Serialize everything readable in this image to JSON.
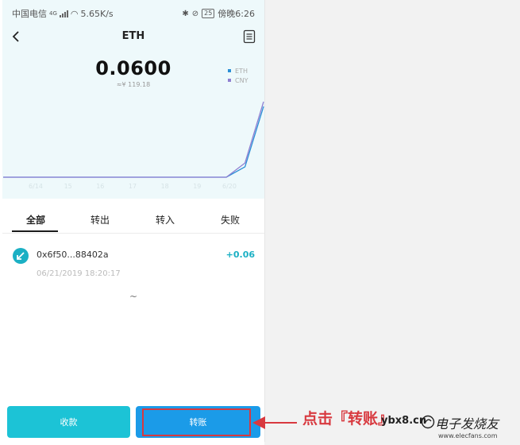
{
  "status_bar": {
    "carrier": "中国电信",
    "net_badge": "4G",
    "speed": "5.65K/s",
    "battery": "25",
    "time": "傍晚6:26"
  },
  "header": {
    "title": "ETH"
  },
  "balance": {
    "amount": "0.0600",
    "fiat": "≈¥ 119.18"
  },
  "legend": [
    {
      "label": "ETH",
      "color": "#2a8fd6"
    },
    {
      "label": "CNY",
      "color": "#8f7fd1"
    }
  ],
  "chart_data": {
    "type": "line",
    "title": "",
    "xlabel": "",
    "ylabel": "",
    "x_tick_labels": [
      "6/14",
      "15",
      "16",
      "17",
      "18",
      "19",
      "6/20"
    ],
    "grid": false,
    "legend_position": "top-right",
    "series": [
      {
        "name": "ETH",
        "color": "#2a8fd6",
        "values": [
          0,
          0,
          0,
          0,
          0,
          0,
          0,
          0,
          0,
          0,
          0,
          0,
          0,
          0.0083,
          0.0563
        ]
      },
      {
        "name": "CNY",
        "color": "#8f7fd1",
        "values": [
          0,
          0,
          0,
          0,
          0,
          0,
          0,
          0,
          0,
          0,
          0,
          0,
          0,
          0.0113,
          0.06
        ]
      }
    ],
    "ylim": [
      0,
      0.06
    ]
  },
  "tabs": [
    {
      "label": "全部",
      "active": true
    },
    {
      "label": "转出",
      "active": false
    },
    {
      "label": "转入",
      "active": false
    },
    {
      "label": "失败",
      "active": false
    }
  ],
  "transactions": [
    {
      "hash": "0x6f50...88402a",
      "amount": "+0.06",
      "datetime": "06/21/2019 18:20:17"
    }
  ],
  "more_indicator": "~",
  "actions": {
    "receive": "收款",
    "transfer": "转账"
  },
  "annotation": {
    "text": "点击『转账』"
  },
  "watermark": {
    "domain": "ybx8.cn",
    "name": "电子发烧友",
    "url": "www.elecfans.com"
  },
  "colors": {
    "accent": "#1bb0c4",
    "receive_button": "#1cc3d6",
    "transfer_button": "#1b9be8",
    "highlight": "#d8393f"
  }
}
